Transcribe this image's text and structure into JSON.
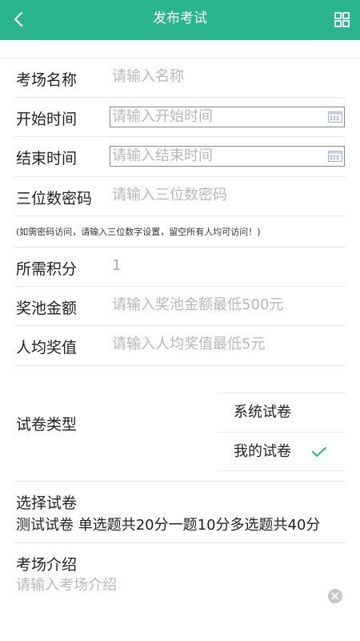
{
  "header": {
    "title": "发布考试"
  },
  "form": {
    "venue_name": {
      "label": "考场名称",
      "placeholder": "请输入名称"
    },
    "start_time": {
      "label": "开始时间",
      "placeholder": "请输入开始时间"
    },
    "end_time": {
      "label": "结束时间",
      "placeholder": "请输入结束时间"
    },
    "password": {
      "label": "三位数密码",
      "placeholder": "请输入三位数密码"
    },
    "password_hint": "(如需密码访问，请输入三位数字设置，留空所有人均可访问！)",
    "points": {
      "label": "所需积分",
      "value": "1"
    },
    "prize_pool": {
      "label": "奖池金额",
      "placeholder": "请输入奖池金额最低500元"
    },
    "per_person": {
      "label": "人均奖值",
      "placeholder": "请输入人均奖值最低5元"
    },
    "paper_type": {
      "label": "试卷类型",
      "options": [
        "系统试卷",
        "我的试卷"
      ],
      "selected": "我的试卷"
    },
    "select_paper": {
      "label": "选择试卷",
      "value": "测试试卷 单选题共20分一题10分多选题共40分"
    },
    "intro": {
      "label": "考场介绍",
      "placeholder": "请输入考场介绍"
    }
  },
  "colors": {
    "header_bg": "#2bb58a",
    "check": "#2bb58a"
  }
}
